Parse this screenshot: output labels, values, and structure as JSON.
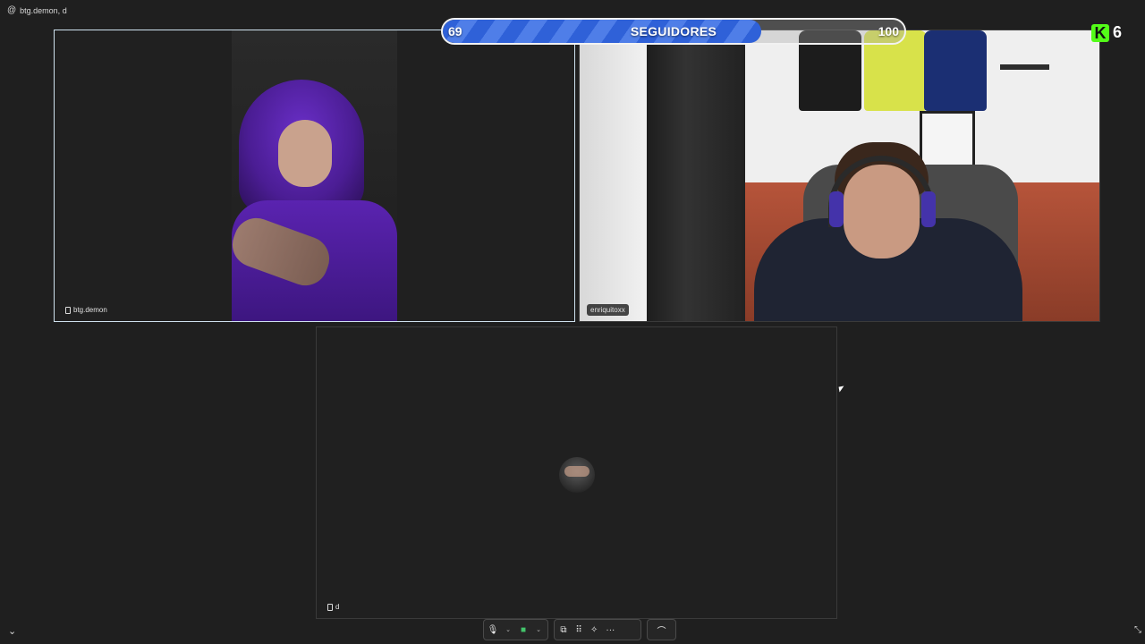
{
  "topbar": {
    "icon": "at-icon",
    "username": "btg.demon, d"
  },
  "followers_bar": {
    "current": "69",
    "goal": "100",
    "label": "SEGUIDORES",
    "progress_fraction": 0.69,
    "colors": {
      "fill": "#2f61d8",
      "fill_stripe": "#4f7ee8",
      "border": "#f2f2f2"
    }
  },
  "kick": {
    "logo_letter": "K",
    "viewer_count": "6",
    "brand_color": "#53fc18"
  },
  "participants": [
    {
      "name": "btg.demon",
      "device_icon": "phone-icon",
      "active": true
    },
    {
      "name": "enriquitoxx",
      "active": false
    },
    {
      "name": "d",
      "device_icon": "phone-icon",
      "active": false
    }
  ],
  "controls": {
    "mic_icon": "🎙",
    "chevron": "⌄",
    "camera_icon": "■",
    "share_icon": "⧉",
    "grid_icon": "⠿",
    "effects_icon": "✧",
    "more_icon": "···",
    "hangup_icon": "⌒"
  },
  "corner": {
    "collapse_icon": "⌄",
    "fullscreen_icon": "⤡"
  }
}
